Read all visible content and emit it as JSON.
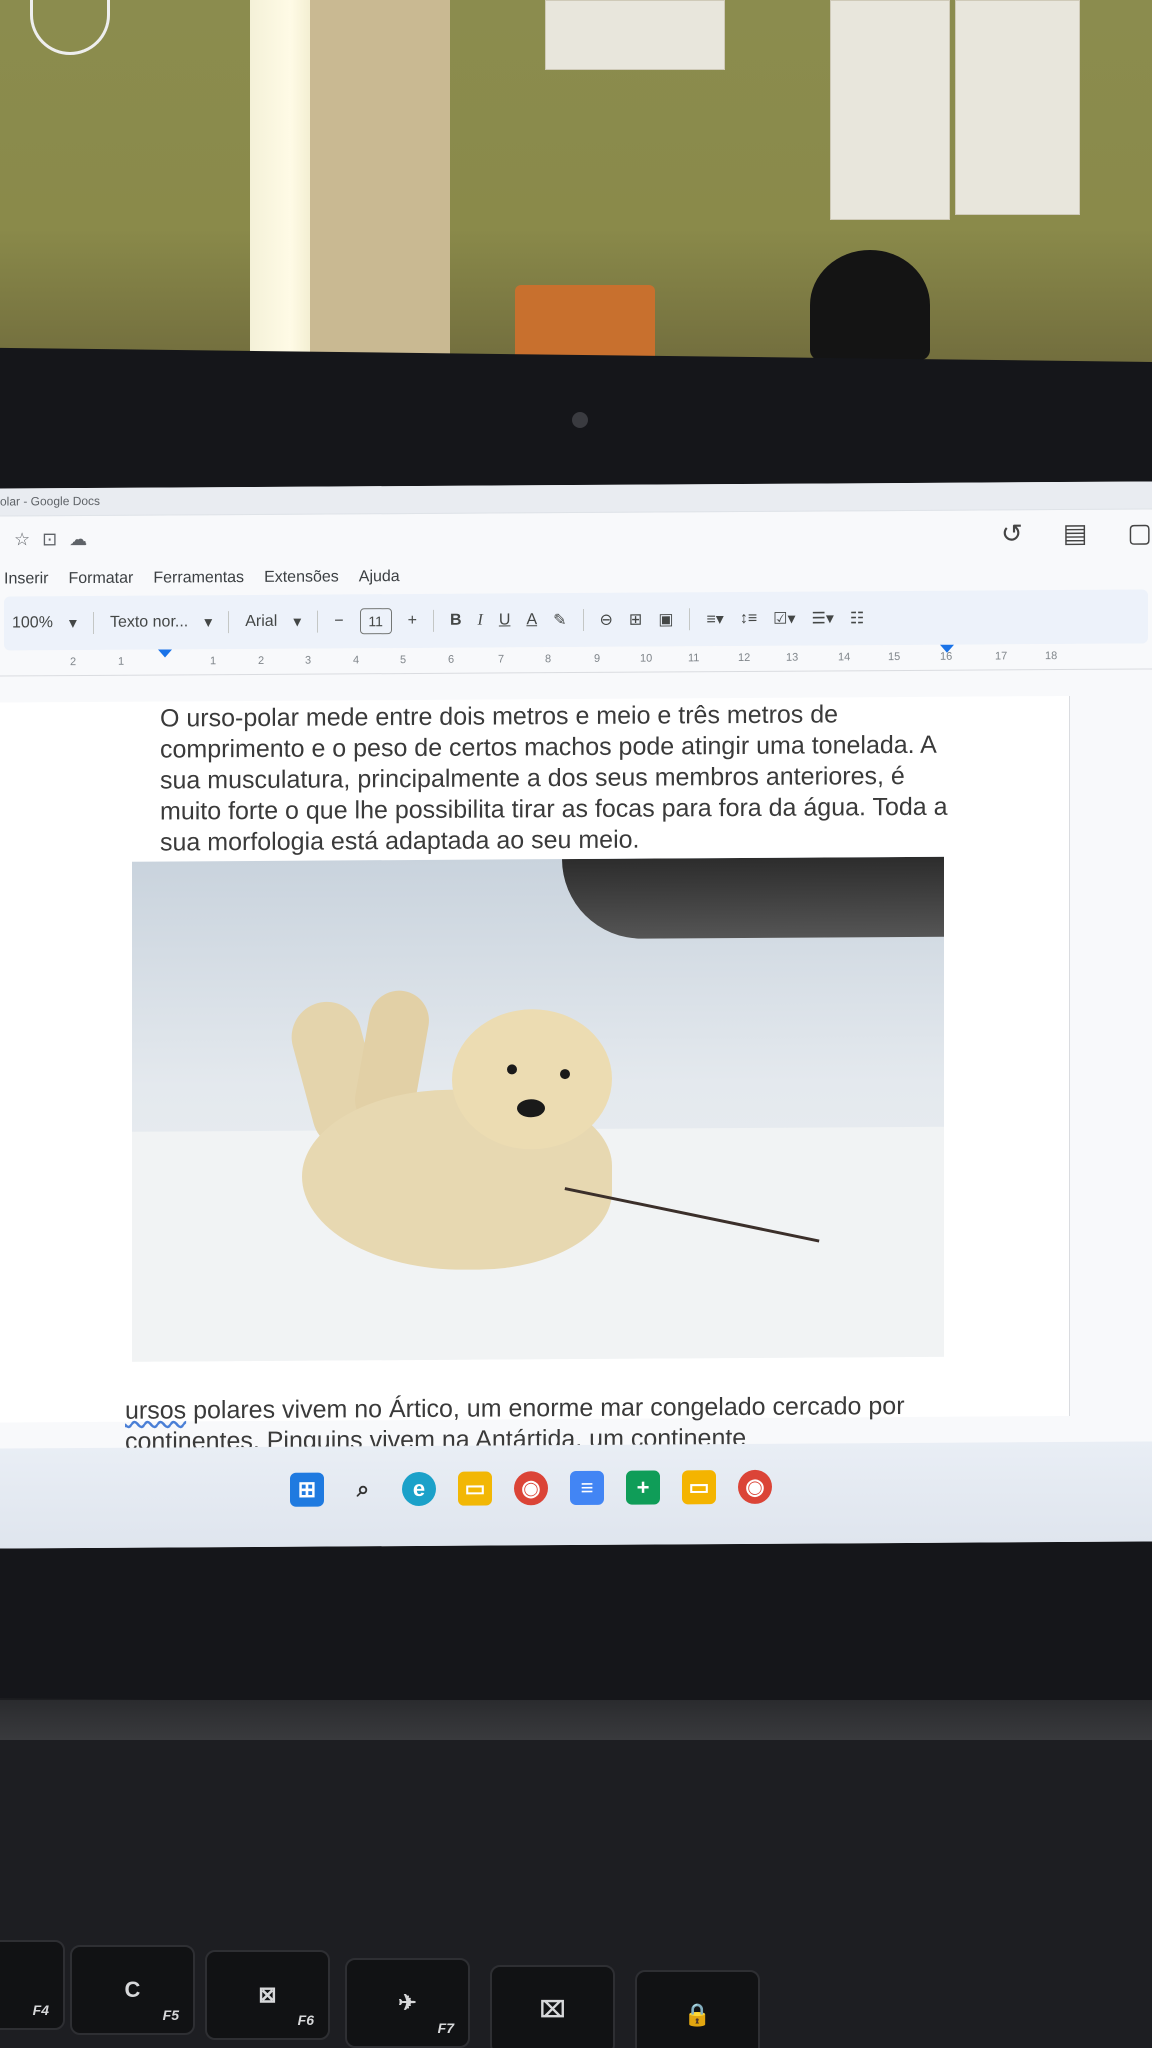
{
  "window": {
    "title": "olar - Google Docs"
  },
  "menubar": {
    "items": [
      "Inserir",
      "Formatar",
      "Ferramentas",
      "Extensões",
      "Ajuda"
    ]
  },
  "toolbar": {
    "zoom": "100%",
    "style": "Texto nor...",
    "font": "Arial",
    "minus": "−",
    "font_size": "11",
    "plus": "+",
    "bold": "B",
    "italic": "I",
    "underline": "U",
    "text_color": "A"
  },
  "ruler": {
    "ticks": [
      "2",
      "1",
      "1",
      "2",
      "3",
      "4",
      "5",
      "6",
      "7",
      "8",
      "9",
      "10",
      "11",
      "12",
      "13",
      "14",
      "15",
      "16",
      "17",
      "18"
    ]
  },
  "document": {
    "paragraph1": "O urso-polar mede entre dois metros e meio e três metros de comprimento e o peso de certos machos pode atingir uma tonelada. A sua musculatura, principalmente a dos seus membros anteriores, é muito forte o que lhe possibilita tirar as focas para fora da água. Toda a sua morfologia está adaptada ao seu meio.",
    "paragraph2_first_word": "ursos",
    "paragraph2_rest": " polares vivem no Ártico, um enorme mar congelado cercado por continentes. Pinguins vivem na Antártida, um continente"
  },
  "keyboard": {
    "keys": [
      {
        "glyph": "",
        "fn": "F4"
      },
      {
        "glyph": "C",
        "fn": "F5"
      },
      {
        "glyph": "⊠",
        "fn": "F6"
      },
      {
        "glyph": "✈",
        "fn": "F7"
      },
      {
        "glyph": "⌧",
        "fn": ""
      },
      {
        "glyph": "🔒",
        "fn": ""
      }
    ]
  },
  "colors": {
    "accent": "#1a73e8",
    "toolbar_bg": "#edf2fa",
    "bezel": "#15161a"
  }
}
